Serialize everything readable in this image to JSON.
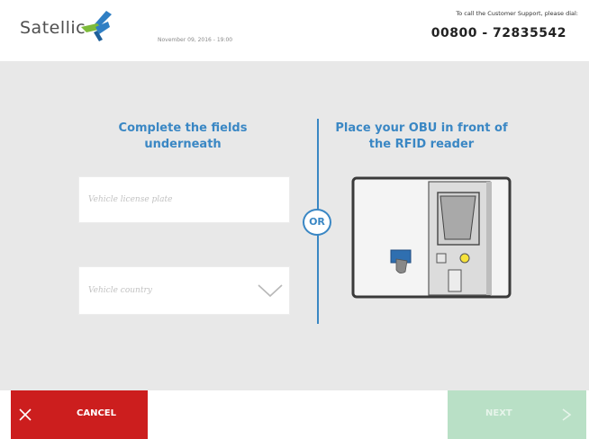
{
  "header": {
    "logo_text": "Satellic",
    "datetime": "November 09, 2016 - 19:00",
    "support_label": "To call the Customer Support, please dial:",
    "support_number": "00800 - 72835542"
  },
  "main": {
    "left_title": "Complete the fields underneath",
    "right_title": "Place your OBU in front of the RFID reader",
    "or_label": "OR",
    "license_plate_placeholder": "Vehicle license plate",
    "country_placeholder": "Vehicle country"
  },
  "footer": {
    "cancel_label": "CANCEL",
    "next_label": "NEXT"
  },
  "icons": {
    "logo": "satellic-bird-icon",
    "close": "close-icon",
    "chevron": "chevron-down-icon",
    "next": "chevron-right-icon",
    "reader": "rfid-reader-illustration"
  },
  "colors": {
    "accent_blue": "#3a87c4",
    "cancel_red": "#cc1e1e",
    "next_green_disabled": "#b9e0c6",
    "main_background": "#e8e8e8",
    "logo_blue": "#2f7fc4",
    "logo_green": "#7dbb3a"
  }
}
